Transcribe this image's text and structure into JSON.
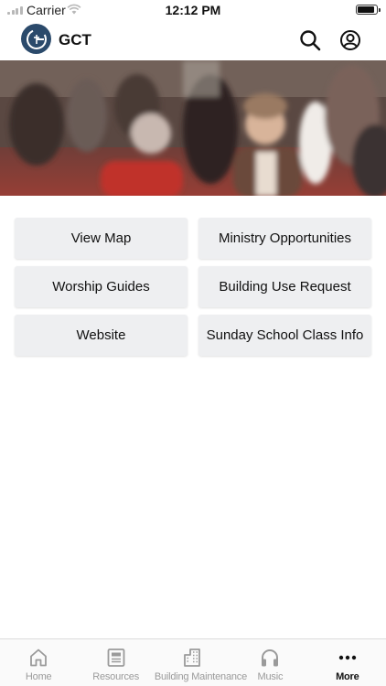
{
  "status_bar": {
    "carrier": "Carrier",
    "time": "12:12 PM",
    "battery_level": 0.95
  },
  "header": {
    "title": "GCT",
    "logo_icon": "gct-logo-icon",
    "search_icon": "search-icon",
    "profile_icon": "profile-icon"
  },
  "banner": {
    "image": "congregation-photo"
  },
  "buttons": [
    {
      "label": "View Map"
    },
    {
      "label": "Ministry Opportunities"
    },
    {
      "label": "Worship Guides"
    },
    {
      "label": "Building Use Request"
    },
    {
      "label": "Website"
    },
    {
      "label": "Sunday School Class Info"
    }
  ],
  "tabs": [
    {
      "label": "Home",
      "icon": "home-icon",
      "active": false
    },
    {
      "label": "Resources",
      "icon": "document-icon",
      "active": false
    },
    {
      "label": "Building Maintenance",
      "icon": "building-icon",
      "active": false
    },
    {
      "label": "Music",
      "icon": "headphones-icon",
      "active": false
    },
    {
      "label": "More",
      "icon": "more-icon",
      "active": true
    }
  ],
  "colors": {
    "logo_bg": "#2b4a6b",
    "button_bg": "#eeeff1",
    "inactive_tab": "#9a9a9a",
    "active_tab": "#111111"
  }
}
